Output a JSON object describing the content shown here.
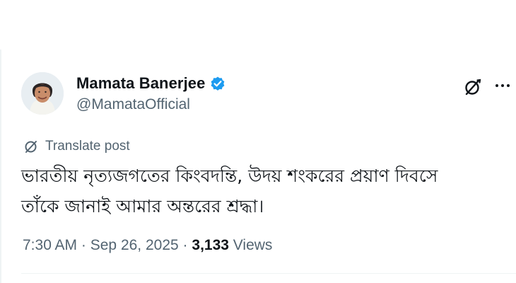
{
  "tweet": {
    "display_name": "Mamata Banerjee",
    "handle": "@MamataOfficial",
    "translate_label": "Translate post",
    "text_line1": "ভারতীয় নৃত্যজগতের কিংবদন্তি, উদয় শংকরের প্রয়াণ দিবসে",
    "text_line2": "তাঁকে জানাই আমার অন্তরের শ্রদ্ধা।",
    "time": "7:30 AM",
    "separator": "·",
    "date": "Sep 26, 2025",
    "views_count": "3,133",
    "views_label": "Views"
  },
  "icons": {
    "verified": "verified-badge-icon",
    "grok": "grok-icon",
    "more": "more-options-icon",
    "translate": "translate-icon"
  },
  "colors": {
    "verified_blue": "#1d9bf0",
    "secondary_text": "#536471",
    "primary_text": "#0f1419"
  }
}
